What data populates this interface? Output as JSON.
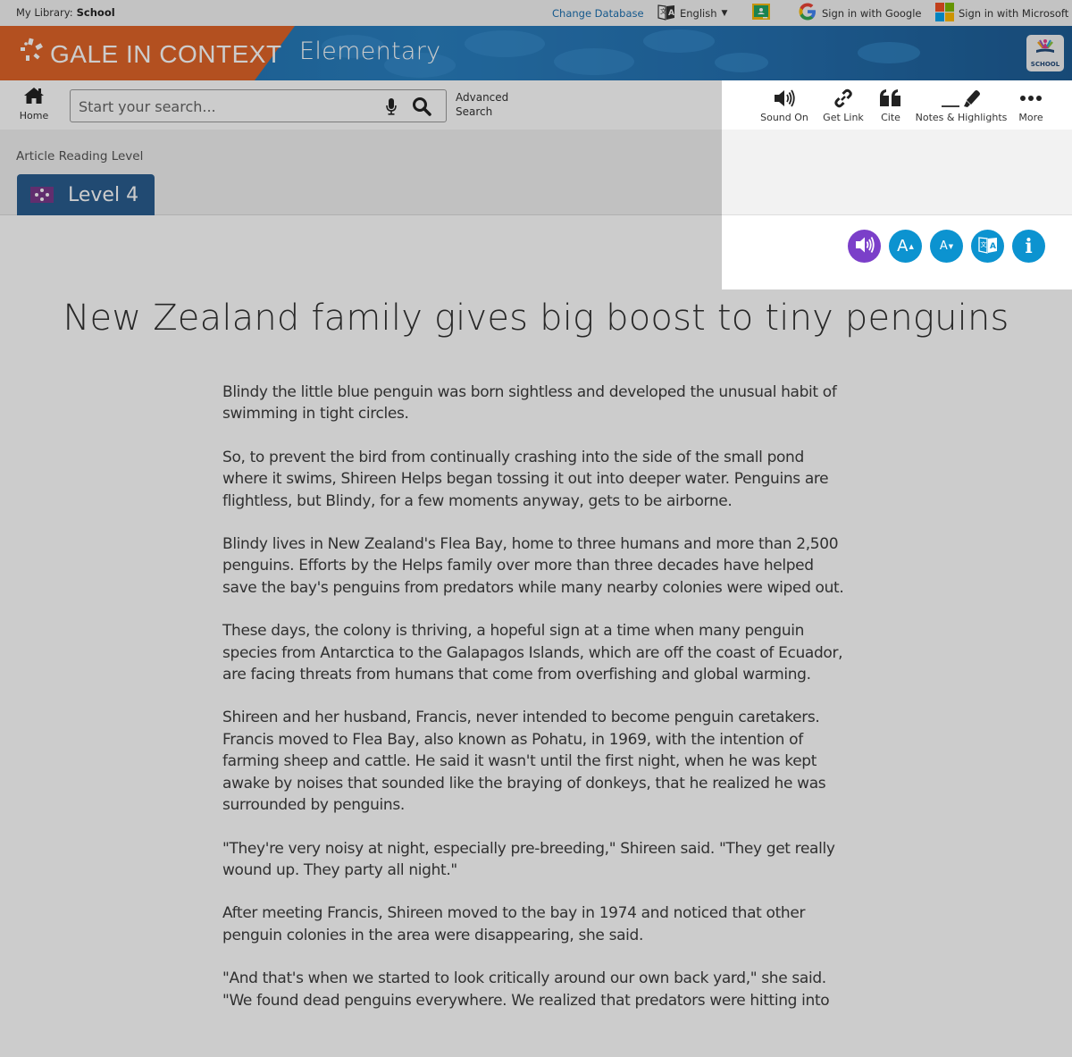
{
  "utility_bar": {
    "library_label": "My Library:",
    "library_name": "School",
    "change_database": "Change Database",
    "language": "English",
    "sign_in_google": "Sign in with Google",
    "sign_in_microsoft": "Sign in with Microsoft"
  },
  "banner": {
    "brand": "GALE IN CONTEXT",
    "product": "Elementary",
    "school_badge": "SCHOOL",
    "colors": {
      "brand_orange": "#e06428",
      "banner_blue": "#2a80c0"
    }
  },
  "navbar": {
    "home_label": "Home",
    "search_placeholder": "Start your search...",
    "advanced_search_line1": "Advanced",
    "advanced_search_line2": "Search",
    "tools": [
      {
        "label": "Sound On",
        "icon": "speaker-icon"
      },
      {
        "label": "Get Link",
        "icon": "link-icon"
      },
      {
        "label": "Cite",
        "icon": "quote-icon"
      },
      {
        "label": "Notes & Highlights",
        "icon": "highlighter-icon"
      },
      {
        "label": "More",
        "icon": "ellipsis-icon"
      }
    ]
  },
  "reading_level": {
    "label": "Article Reading Level",
    "value": "Level 4",
    "color": "#2a5d8f"
  },
  "round_tools": [
    {
      "name": "read-aloud",
      "icon": "speaker-icon",
      "color": "#7b3fc9"
    },
    {
      "name": "increase-font",
      "icon": "font-increase-icon",
      "text": "A",
      "color": "#0c93d0"
    },
    {
      "name": "decrease-font",
      "icon": "font-decrease-icon",
      "text": "A",
      "color": "#0c93d0"
    },
    {
      "name": "translate",
      "icon": "translate-icon",
      "color": "#0c93d0"
    },
    {
      "name": "info",
      "icon": "info-icon",
      "text": "i",
      "color": "#0c93d0"
    }
  ],
  "article": {
    "title": "New Zealand family gives big boost to tiny penguins",
    "paragraphs": [
      "Blindy the little blue penguin was born sightless and developed the unusual habit of swimming in tight circles.",
      "So, to prevent the bird from continually crashing into the side of the small pond where it swims, Shireen Helps began tossing it out into deeper water. Penguins are flightless, but Blindy, for a few moments anyway, gets to be airborne.",
      "Blindy lives in New Zealand's Flea Bay, home to three humans and more than 2,500 penguins. Efforts by the Helps family over more than three decades have helped save the bay's penguins from predators while many nearby colonies were wiped out.",
      "These days, the colony is thriving, a hopeful sign at a time when many penguin species from Antarctica to the Galapagos Islands, which are off the coast of Ecuador, are facing threats from humans that come from overfishing and global warming.",
      "Shireen and her husband, Francis, never intended to become penguin caretakers. Francis moved to Flea Bay, also known as Pohatu, in 1969, with the intention of farming sheep and cattle. He said it wasn't until the first night, when he was kept awake by noises that sounded like the braying of donkeys, that he realized he was surrounded by penguins.",
      "\"They're very noisy at night, especially pre-breeding,\" Shireen said. \"They get really wound up. They party all night.\"",
      "After meeting Francis, Shireen moved to the bay in 1974 and noticed that other penguin colonies in the area were disappearing, she said.",
      "\"And that's when we started to look critically around our own back yard,\" she said. \"We found dead penguins everywhere. We realized that predators were hitting into"
    ]
  }
}
